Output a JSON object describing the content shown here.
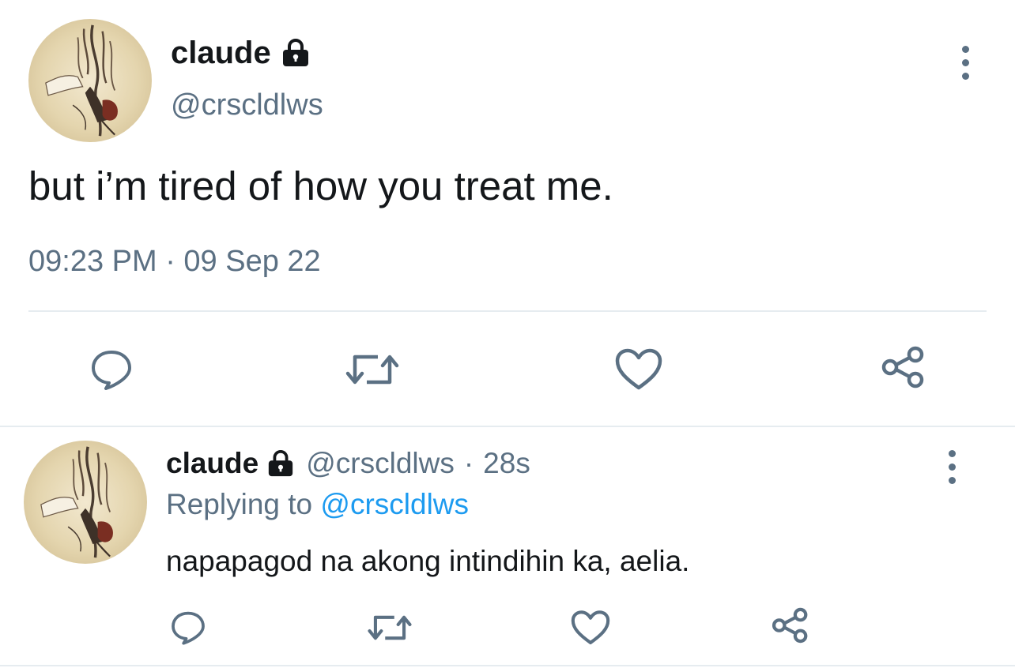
{
  "main_tweet": {
    "display_name": "claude",
    "handle": "@crscldlws",
    "text": "but i’m tired of how you treat me.",
    "timestamp": "09:23 PM · 09 Sep 22",
    "icons": {
      "lock": "lock-icon",
      "more": "more-vertical-icon",
      "reply": "reply-icon",
      "retweet": "retweet-icon",
      "like": "heart-icon",
      "share": "share-icon"
    }
  },
  "reply_tweet": {
    "display_name": "claude",
    "handle": "@crscldlws",
    "separator": "·",
    "age": "28s",
    "replying_prefix": "Replying to",
    "replying_handle": "@crscldlws",
    "text": "napapagod na akong intindihin ka, aelia."
  },
  "colors": {
    "text": "#14171a",
    "secondary": "#5b7083",
    "link": "#1d9bf0",
    "divider": "#e6ecf0"
  }
}
